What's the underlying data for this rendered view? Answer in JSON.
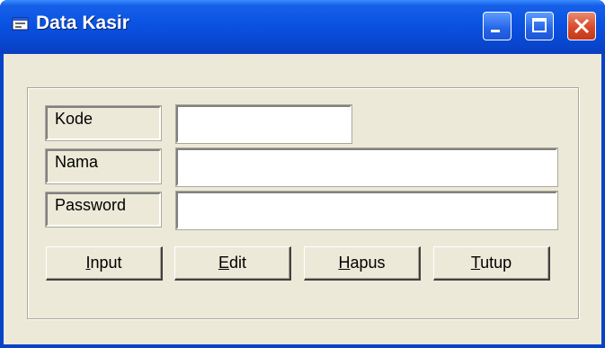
{
  "window": {
    "title": "Data Kasir",
    "buttons": [
      "minimize",
      "maximize",
      "close"
    ]
  },
  "fields": [
    {
      "label": "Kode",
      "value": ""
    },
    {
      "label": "Nama",
      "value": ""
    },
    {
      "label": "Password",
      "value": ""
    }
  ],
  "actions": [
    {
      "accel": "I",
      "rest": "nput"
    },
    {
      "accel": "E",
      "rest": "dit"
    },
    {
      "accel": "H",
      "rest": "apus"
    },
    {
      "accel": "T",
      "rest": "utup"
    }
  ],
  "icons": {
    "title": "form-window-icon",
    "minimize": "minimize-icon",
    "maximize": "maximize-icon",
    "close": "close-icon"
  },
  "colors": {
    "titlebar": "#0A52E2",
    "window_bg": "#ECE9D8",
    "close_button": "#D94A2A"
  }
}
